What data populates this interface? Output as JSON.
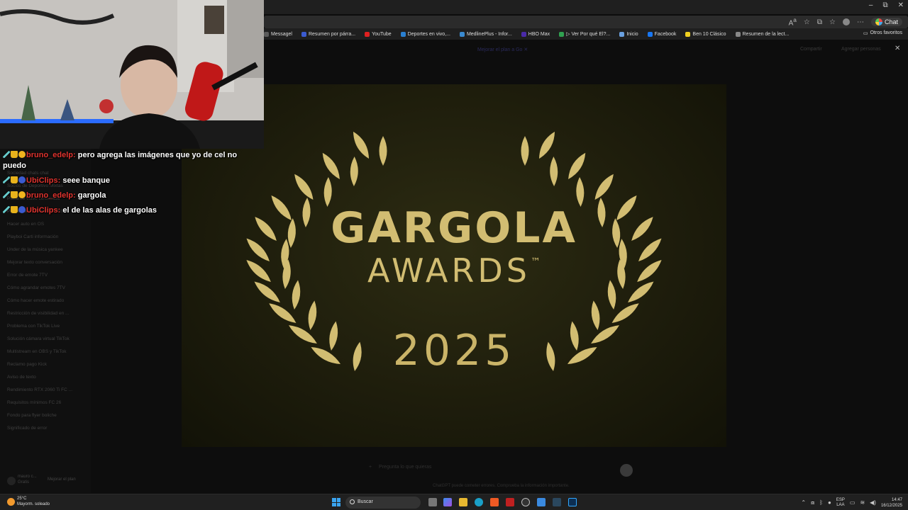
{
  "window": {
    "minimize": "–",
    "maximize": "⧉",
    "close": "✕"
  },
  "address_bar": {
    "chat_label": "Chat"
  },
  "bookmarks": [
    {
      "label": "Messagel",
      "color": "#5a5a5a"
    },
    {
      "label": "Resumen por párra...",
      "color": "#3b5bd0"
    },
    {
      "label": "YouTube",
      "color": "#e02020"
    },
    {
      "label": "Deportes en vivo,...",
      "color": "#2a7fd0"
    },
    {
      "label": "MedlinePlus - Infor...",
      "color": "#3a8ad0"
    },
    {
      "label": "HBO Max",
      "color": "#4a2aa8"
    },
    {
      "label": "▷ Ver Por qué El?...",
      "color": "#30a050"
    },
    {
      "label": "Inicio",
      "color": "#6aa0e0"
    },
    {
      "label": "Facebook",
      "color": "#1877f2"
    },
    {
      "label": "Ben 10 Clásico",
      "color": "#f0d020"
    },
    {
      "label": "Resumen de la lect...",
      "color": "#888888"
    }
  ],
  "bookmarks_other": "Otros favoritos",
  "topbar": {
    "plan": "Mejorar el plan a Go ✕",
    "share": "Compartir",
    "add_people": "Agregar personas",
    "close": "✕"
  },
  "sidebar": {
    "items": [
      "Sociedad chats chat",
      "Socios de Deportivo Mixtas",
      "Placa de video certificada",
      "Problema rendimiento OBS",
      "Hacer auto en OS",
      "Playboi Carti información",
      "Under de la música yankee",
      "Mejorar texto conversación",
      "Error de emote 7TV",
      "Cómo agrandar emotes 7TV",
      "Cómo hacer emote estirado",
      "Restricción de visibilidad en ...",
      "Problema con TikTok Live",
      "Solución cámara virtual TikTok",
      "Multistream en OBS y TikTok",
      "Reclamo pago Kick",
      "Aviso de texto",
      "Rendimiento RTX 2060 Ti FC ...",
      "Requisitos mínimos FC 26",
      "Fondo para flyer boliche",
      "Significado de error"
    ],
    "footer_user": "mauro c...",
    "footer_plan": "Gratis",
    "footer_button": "Mejorar el plan"
  },
  "composer": {
    "placeholder": "Pregunta lo que quieras",
    "disclaimer": "ChatGPT puede cometer errores. Comprueba la información importante."
  },
  "award_image": {
    "line1": "GARGOLA",
    "line2": "AWARDS",
    "trademark": "™",
    "year": "2025",
    "gold": "#d2bd72"
  },
  "chat": [
    {
      "user": "bruno_edelp:",
      "text": "pero agrega las imágenes que yo de cel no puedo",
      "badges": [
        "sword",
        "crown",
        "coin"
      ]
    },
    {
      "user": "UbiClips:",
      "text": "seee banque",
      "badges": [
        "sword",
        "crown",
        "blue"
      ]
    },
    {
      "user": "bruno_edelp:",
      "text": "gargola",
      "badges": [
        "sword",
        "crown",
        "coin"
      ]
    },
    {
      "user": "UbiClips:",
      "text": "el de las alas de gargolas",
      "badges": [
        "sword",
        "crown",
        "blue"
      ]
    }
  ],
  "taskbar": {
    "weather_temp": "25°C",
    "weather_desc": "Mayorm. soleado",
    "search_label": "Buscar",
    "lang_top": "ESP",
    "lang_bottom": "LAA",
    "time": "14:47",
    "date": "16/12/2025",
    "tray_chevron": "⌃"
  }
}
